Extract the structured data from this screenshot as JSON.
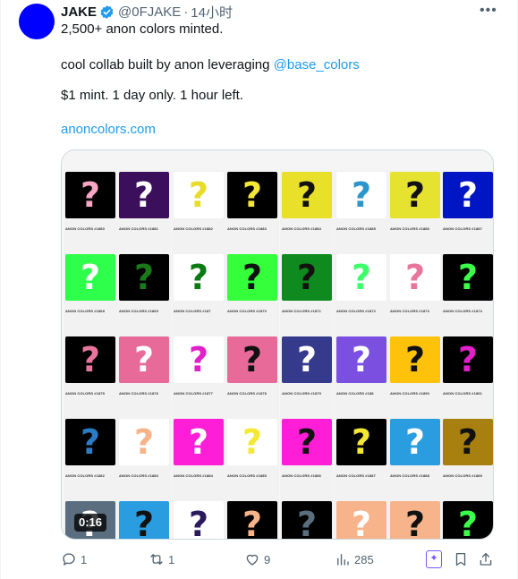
{
  "tweet": {
    "author_name": "JAKE",
    "handle": "@0FJAKE",
    "separator": "·",
    "time": "14小时",
    "avatar_color": "#0000ff",
    "line1": "2,500+ anon colors minted.",
    "line2_prefix": "cool collab built by anon leveraging ",
    "line2_mention": "@base_colors",
    "line3": "$1 mint. 1 day only. 1 hour left.",
    "link": "anoncolors.com"
  },
  "media": {
    "duration": "0:16",
    "rows": [
      [
        {
          "bg": "#000000",
          "q": "#f7a6c4",
          "cap": "ANON COLORS #1880"
        },
        {
          "bg": "#3b0f5c",
          "q": "#ffffff",
          "cap": "ANON COLORS #1881"
        },
        {
          "bg": "#ffffff",
          "q": "#e8dc2a",
          "cap": "ANON COLORS #1882"
        },
        {
          "bg": "#000000",
          "q": "#f4e834",
          "cap": "ANON COLORS #1883"
        },
        {
          "bg": "#e9e02a",
          "q": "#111111",
          "cap": "ANON COLORS #1884"
        },
        {
          "bg": "#ffffff",
          "q": "#2a96cc",
          "cap": "ANON COLORS #1885"
        },
        {
          "bg": "#e5e230",
          "q": "#111111",
          "cap": "ANON COLORS #1886"
        },
        {
          "bg": "#0015c4",
          "q": "#ffffff",
          "cap": "ANON COLORS #1887"
        }
      ],
      [
        {
          "bg": "#2dff4a",
          "q": "#ffffff",
          "cap": "ANON COLORS #1868"
        },
        {
          "bg": "#000000",
          "q": "#1a7a1a",
          "cap": "ANON COLORS #1869"
        },
        {
          "bg": "#ffffff",
          "q": "#0c7a12",
          "cap": "ANON COLORS #187"
        },
        {
          "bg": "#34ff3a",
          "q": "#111111",
          "cap": "ANON COLORS #1870"
        },
        {
          "bg": "#0f8a1e",
          "q": "#111111",
          "cap": "ANON COLORS #1871"
        },
        {
          "bg": "#ffffff",
          "q": "#3cff6a",
          "cap": "ANON COLORS #1872"
        },
        {
          "bg": "#ffffff",
          "q": "#e8769c",
          "cap": "ANON COLORS #1873"
        },
        {
          "bg": "#000000",
          "q": "#3cff4a",
          "cap": "ANON COLORS #1874"
        }
      ],
      [
        {
          "bg": "#000000",
          "q": "#e8769c",
          "cap": "ANON COLORS #1875"
        },
        {
          "bg": "#e86a98",
          "q": "#ffffff",
          "cap": "ANON COLORS #1876"
        },
        {
          "bg": "#ffffff",
          "q": "#e020c8",
          "cap": "ANON COLORS #1877"
        },
        {
          "bg": "#e86a98",
          "q": "#111111",
          "cap": "ANON COLORS #1878"
        },
        {
          "bg": "#363a8c",
          "q": "#ffffff",
          "cap": "ANON COLORS #1879"
        },
        {
          "bg": "#7b4fe0",
          "q": "#ffffff",
          "cap": "ANON COLORS #188"
        },
        {
          "bg": "#ffc20a",
          "q": "#111111",
          "cap": "ANON COLORS #1890"
        },
        {
          "bg": "#000000",
          "q": "#e020c8",
          "cap": "ANON COLORS #1891"
        }
      ],
      [
        {
          "bg": "#000000",
          "q": "#2a7cc4",
          "cap": "ANON COLORS #1882"
        },
        {
          "bg": "#ffffff",
          "q": "#f7b38a",
          "cap": "ANON COLORS #1883"
        },
        {
          "bg": "#ff1ed8",
          "q": "#ffffff",
          "cap": "ANON COLORS #1884"
        },
        {
          "bg": "#ffffff",
          "q": "#f4e834",
          "cap": "ANON COLORS #1885"
        },
        {
          "bg": "#ff1ed8",
          "q": "#111111",
          "cap": "ANON COLORS #1886"
        },
        {
          "bg": "#000000",
          "q": "#f4e834",
          "cap": "ANON COLORS #1887"
        },
        {
          "bg": "#2a9ce0",
          "q": "#ffffff",
          "cap": "ANON COLORS #1888"
        },
        {
          "bg": "#a88010",
          "q": "#111111",
          "cap": "ANON COLORS #1889"
        }
      ],
      [
        {
          "bg": "#5a6e80",
          "q": "#ffffff",
          "cap": ""
        },
        {
          "bg": "#2a9ce0",
          "q": "#111111",
          "cap": ""
        },
        {
          "bg": "#ffffff",
          "q": "#2a1a5c",
          "cap": ""
        },
        {
          "bg": "#000000",
          "q": "#f7b38a",
          "cap": ""
        },
        {
          "bg": "#000000",
          "q": "#5a6e80",
          "cap": ""
        },
        {
          "bg": "#f7b38a",
          "q": "#ffffff",
          "cap": ""
        },
        {
          "bg": "#f7b38a",
          "q": "#111111",
          "cap": ""
        },
        {
          "bg": "#000000",
          "q": "#3cff4a",
          "cap": ""
        }
      ]
    ]
  },
  "actions": {
    "reply_count": "1",
    "retweet_count": "1",
    "like_count": "9",
    "views_count": "285"
  },
  "icons": {
    "verified": "verified-badge-icon",
    "more": "more-dots-icon",
    "reply": "reply-icon",
    "retweet": "retweet-icon",
    "like": "heart-icon",
    "views": "views-chart-icon",
    "grok": "grok-icon",
    "bookmark": "bookmark-icon",
    "share": "share-icon"
  },
  "colors": {
    "accent": "#1d9bf0",
    "muted": "#536471",
    "grok": "#7856ff"
  }
}
